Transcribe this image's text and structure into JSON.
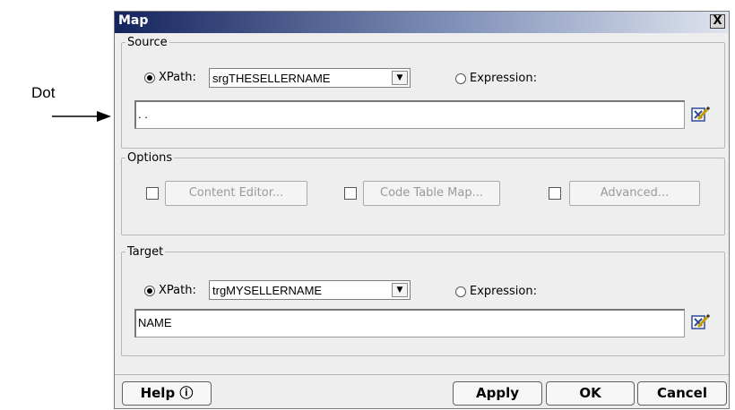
{
  "annotation": {
    "label": "Dot"
  },
  "dialog": {
    "title": "Map",
    "close_label": "X",
    "source": {
      "legend": "Source",
      "xpath_label": "XPath:",
      "xpath_value": "srgTHESELLERNAME",
      "xpath_selected": true,
      "expression_label": "Expression:",
      "expression_selected": false,
      "text_value": ". ."
    },
    "options": {
      "legend": "Options",
      "items": [
        {
          "label": "Content Editor...",
          "checked": false,
          "enabled": false
        },
        {
          "label": "Code Table Map...",
          "checked": false,
          "enabled": false
        },
        {
          "label": "Advanced...",
          "checked": false,
          "enabled": false
        }
      ]
    },
    "target": {
      "legend": "Target",
      "xpath_label": "XPath:",
      "xpath_value": "trgMYSELLERNAME",
      "xpath_selected": true,
      "expression_label": "Expression:",
      "expression_selected": false,
      "text_value": "NAME"
    },
    "buttons": {
      "help": "Help ⓘ",
      "apply": "Apply",
      "ok": "OK",
      "cancel": "Cancel"
    }
  }
}
